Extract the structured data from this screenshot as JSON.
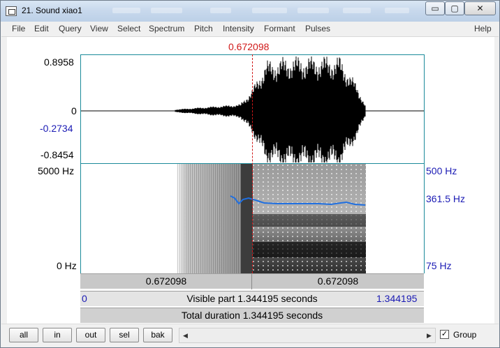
{
  "window": {
    "title": "21. Sound xiao1",
    "controls": {
      "minimize": "▭",
      "maximize": "▢",
      "close": "✕"
    }
  },
  "menu": [
    "File",
    "Edit",
    "Query",
    "View",
    "Select",
    "Spectrum",
    "Pitch",
    "Intensity",
    "Formant",
    "Pulses"
  ],
  "help_label": "Help",
  "cursor_time": "0.672098",
  "waveform": {
    "ymax": "0.8958",
    "zero": "0",
    "cursor_value": "-0.2734",
    "ymin": "-0.8454"
  },
  "spectrogram": {
    "fmax": "5000 Hz",
    "fmin": "0 Hz",
    "pitch_top": "500 Hz",
    "pitch_value": "361.5 Hz",
    "pitch_bottom": "75 Hz"
  },
  "time_bar": {
    "left": "0.672098",
    "right": "0.672098"
  },
  "visible_bar": {
    "start": "0",
    "text": "Visible part 1.344195 seconds",
    "end": "1.344195"
  },
  "total_bar": {
    "text": "Total duration 1.344195 seconds"
  },
  "buttons": {
    "all": "all",
    "in": "in",
    "out": "out",
    "sel": "sel",
    "bak": "bak"
  },
  "group": {
    "label": "Group",
    "checked": "✓"
  },
  "colors": {
    "cursor": "#d01818",
    "pitch": "#1f6fe0",
    "axis_blue": "#1a1ab4",
    "frame": "#1a8a9a"
  },
  "icons": {
    "scroll_left": "◀",
    "scroll_right": "▶"
  }
}
